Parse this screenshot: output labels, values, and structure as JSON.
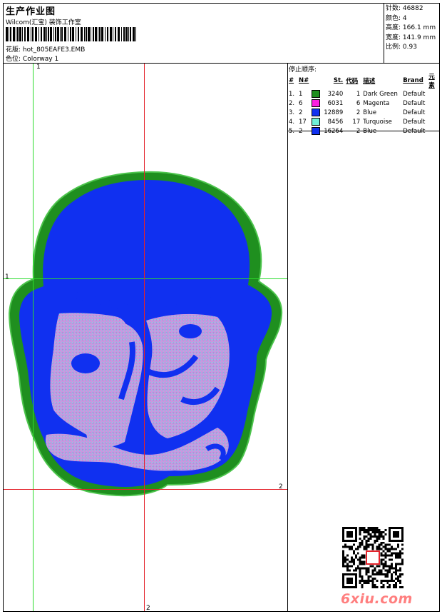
{
  "header": {
    "title": "生产作业图",
    "company": "Wilcom(汇宝) 装饰工作室",
    "design_label": "花版:",
    "design_value": "hot_805EAFE3.EMB",
    "colorway_label": "色位:",
    "colorway_value": "Colorway 1"
  },
  "stats": [
    {
      "label": "针数:",
      "value": "46882"
    },
    {
      "label": "颜色:",
      "value": "4"
    },
    {
      "label": "高度:",
      "value": "166.1 mm"
    },
    {
      "label": "宽度:",
      "value": "141.9 mm"
    },
    {
      "label": "比例:",
      "value": "0.93"
    }
  ],
  "stop_sequence": {
    "title": "停止顺序:",
    "columns": [
      "#",
      "N#",
      "St.",
      "代码",
      "描述",
      "Brand",
      "元素"
    ],
    "rows": [
      {
        "idx": "1.",
        "n": "1",
        "color": "#1f8f1f",
        "stitches": "3240",
        "code": "1",
        "desc": "Dark Green",
        "brand": "Default"
      },
      {
        "idx": "2.",
        "n": "6",
        "color": "#ff1fe0",
        "stitches": "6031",
        "code": "6",
        "desc": "Magenta",
        "brand": "Default"
      },
      {
        "idx": "3.",
        "n": "2",
        "color": "#1030f0",
        "stitches": "12889",
        "code": "2",
        "desc": "Blue",
        "brand": "Default"
      },
      {
        "idx": "4.",
        "n": "17",
        "color": "#6ff0d8",
        "stitches": "8456",
        "code": "17",
        "desc": "Turquoise",
        "brand": "Default"
      },
      {
        "idx": "5.",
        "n": "2",
        "color": "#1030f0",
        "stitches": "16264",
        "code": "2",
        "desc": "Blue",
        "brand": "Default"
      }
    ]
  },
  "guides": {
    "green_v": "1",
    "green_h": "1",
    "red_h": "2",
    "red_v": "2"
  },
  "colors": {
    "dark_green": "#1f8f1f",
    "blue": "#1030f0",
    "fill": "#b89ad6",
    "guide_green": "#2ddc2d",
    "guide_red": "#e4232b"
  },
  "watermark": "6xiu.com"
}
